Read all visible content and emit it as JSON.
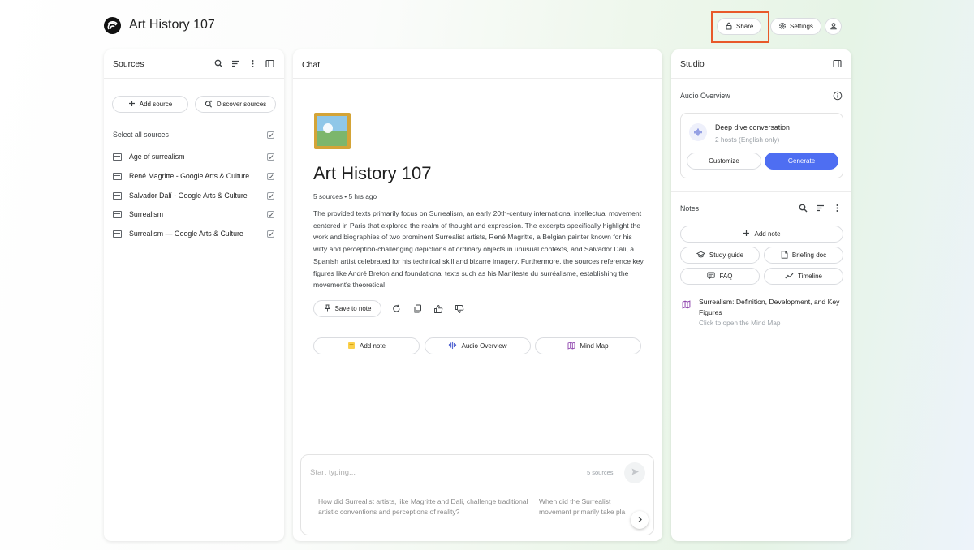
{
  "app": {
    "title": "Art History 107"
  },
  "header": {
    "share_label": "Share",
    "settings_label": "Settings"
  },
  "sources": {
    "title": "Sources",
    "add_label": "Add source",
    "discover_label": "Discover sources",
    "select_all_label": "Select all sources",
    "items": [
      {
        "label": "Age of surrealism"
      },
      {
        "label": "René Magritte - Google Arts & Culture"
      },
      {
        "label": "Salvador Dalí - Google Arts & Culture"
      },
      {
        "label": "Surrealism"
      },
      {
        "label": "Surrealism — Google Arts & Culture"
      }
    ]
  },
  "chat": {
    "title": "Chat",
    "notebook_title": "Art History 107",
    "meta": "5 sources • 5 hrs ago",
    "summary": "The provided texts primarily focus on Surrealism, an early 20th-century international intellectual movement centered in Paris that explored the realm of thought and expression. The excerpts specifically highlight the work and biographies of two prominent Surrealist artists, René Magritte, a Belgian painter known for his witty and perception-challenging depictions of ordinary objects in unusual contexts, and Salvador Dalí, a Spanish artist celebrated for his technical skill and bizarre imagery. Furthermore, the sources reference key figures like André Breton and foundational texts such as his Manifeste du surréalisme, establishing the movement's theoretical",
    "save_to_note_label": "Save to note",
    "chips": {
      "add_note": "Add note",
      "audio_overview": "Audio Overview",
      "mind_map": "Mind Map"
    },
    "composer": {
      "placeholder": "Start typing...",
      "source_count": "5 sources",
      "suggestions": [
        "How did Surrealist artists, like Magritte and Dali, challenge traditional artistic conventions and perceptions of reality?",
        "When did the Surrealist movement primarily take pla"
      ]
    }
  },
  "studio": {
    "title": "Studio",
    "audio_overview_label": "Audio Overview",
    "audio_card": {
      "title": "Deep dive conversation",
      "subtitle": "2 hosts (English only)",
      "customize_label": "Customize",
      "generate_label": "Generate"
    },
    "notes_label": "Notes",
    "add_note_label": "Add note",
    "tools": {
      "study_guide": "Study guide",
      "briefing_doc": "Briefing doc",
      "faq": "FAQ",
      "timeline": "Timeline"
    },
    "note_item": {
      "title": "Surrealism: Definition, Development, and Key Figures",
      "subtitle": "Click to open the Mind Map"
    }
  },
  "colors": {
    "accent": "#4e6ef2",
    "highlight": "#e8592a",
    "mind_map_icon": "#8e44ad"
  },
  "icons": [
    "notebook-logo-icon",
    "lock-icon",
    "gear-icon",
    "person-icon",
    "search-icon",
    "sort-icon",
    "more-vert-icon",
    "sidebar-icon",
    "plus-icon",
    "discover-icon",
    "source-doc-icon",
    "checkbox-icon",
    "pin-icon",
    "refresh-icon",
    "copy-icon",
    "thumbs-up-icon",
    "thumbs-down-icon",
    "note-icon",
    "waveform-icon",
    "mind-map-icon",
    "send-icon",
    "chevron-right-icon",
    "info-icon",
    "graduation-cap-icon",
    "document-icon",
    "faq-icon",
    "timeline-icon"
  ]
}
